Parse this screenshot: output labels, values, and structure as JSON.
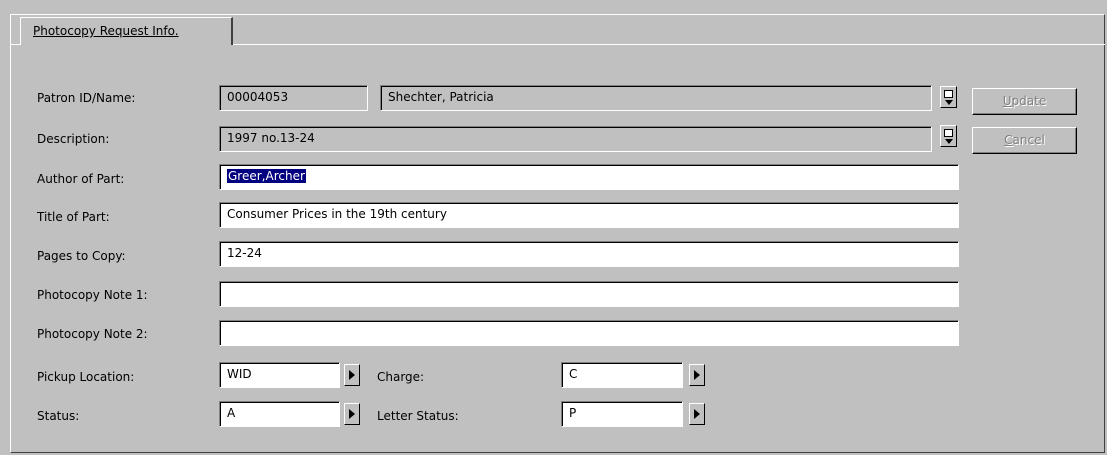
{
  "tab": {
    "label": "Photocopy Request Info."
  },
  "labels": {
    "patron": "Patron ID/Name:",
    "description": "Description:",
    "author": "Author of Part:",
    "title": "Title of Part:",
    "pages": "Pages to Copy:",
    "note1": "Photocopy Note 1:",
    "note2": "Photocopy Note 2:",
    "pickup": "Pickup Location:",
    "status": "Status:",
    "charge": "Charge:",
    "letter_status": "Letter Status:"
  },
  "values": {
    "patron_id": "00004053",
    "patron_name": "Shechter, Patricia",
    "description": "1997 no.13-24",
    "author": "Greer,Archer",
    "title": "Consumer Prices in the 19th century",
    "pages": "12-24",
    "note1": "",
    "note2": "",
    "pickup": "WID",
    "status": "A",
    "charge": "C",
    "letter_status": "P"
  },
  "buttons": {
    "update_accel": "U",
    "update_rest": "pdate",
    "cancel_accel": "C",
    "cancel_rest": "ancel"
  },
  "colors": {
    "background": "#c0c0c0",
    "selection": "#000080",
    "disabled_text": "#808080"
  },
  "state": {
    "update_enabled": false,
    "cancel_enabled": false
  }
}
